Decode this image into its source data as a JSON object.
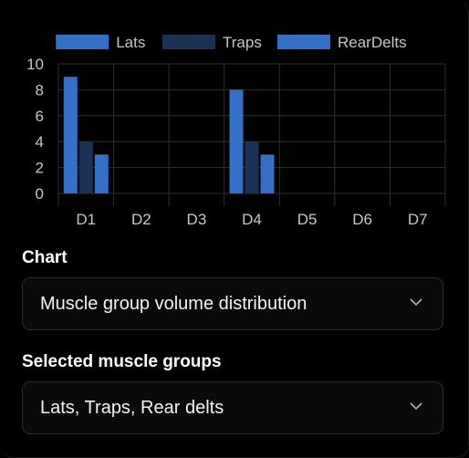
{
  "chart_data": {
    "type": "bar",
    "categories": [
      "D1",
      "D2",
      "D3",
      "D4",
      "D5",
      "D6",
      "D7"
    ],
    "series": [
      {
        "name": "Lats",
        "color": "#3271c7",
        "values": [
          9,
          0,
          0,
          8,
          0,
          0,
          0
        ]
      },
      {
        "name": "Traps",
        "color": "#1a3355",
        "values": [
          4,
          0,
          0,
          4,
          0,
          0,
          0
        ]
      },
      {
        "name": "RearDelts",
        "color": "#3271c7",
        "values": [
          3,
          0,
          0,
          3,
          0,
          0,
          0
        ]
      }
    ],
    "yticks": [
      "0",
      "2",
      "4",
      "6",
      "8",
      "10"
    ],
    "ylim": [
      0,
      10
    ],
    "grid": true,
    "legend_position": "top",
    "title": "",
    "xlabel": "",
    "ylabel": ""
  },
  "controls": {
    "chart_label": "Chart",
    "chart_value": "Muscle group volume distribution",
    "chart_chevron_icon": "chevron-down-icon",
    "muscles_label": "Selected muscle groups",
    "muscles_value": "Lats, Traps, Rear delts",
    "muscles_chevron_icon": "chevron-down-icon"
  },
  "colors": {
    "background": "#000000",
    "grid": "#2e2e2e",
    "axis_text": "#c6c6c6",
    "select_border": "#2b2b2b",
    "text": "#ffffff"
  }
}
